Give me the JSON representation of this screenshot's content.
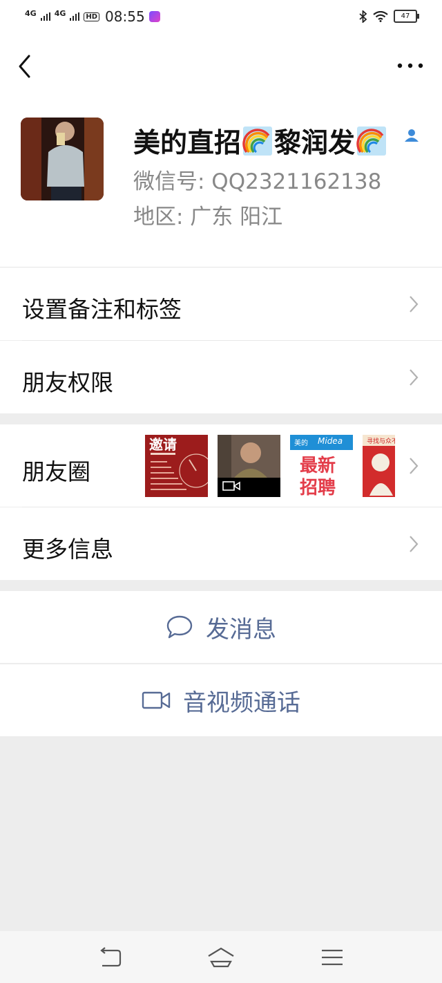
{
  "status_bar": {
    "signal_1": "4G",
    "signal_2": "4G",
    "hd": "HD",
    "time": "08:55",
    "battery": "47"
  },
  "nav": {
    "back_icon": "chevron-left-icon",
    "more_icon": "more-dots-icon"
  },
  "profile": {
    "avatar_icon": "avatar-photo",
    "name_parts": [
      "美的直招",
      "黎润发"
    ],
    "emoji_icon": "rainbow-emoji",
    "wechat_id": "微信号:  QQ2321162138",
    "region": "地区:  广东  阳江"
  },
  "menu": {
    "remark_tags": "设置备注和标签",
    "permissions": "朋友权限",
    "moments": "朋友圈",
    "more_info": "更多信息"
  },
  "moments_thumbs": {
    "t1_title": "邀请",
    "t3_brand_left": "美的",
    "t3_brand_right": "Midea",
    "t3_line1": "最新",
    "t3_line2": "招聘",
    "t4_title": "寻找与众不"
  },
  "actions": {
    "message": "发消息",
    "call": "音视频通话"
  },
  "colors": {
    "link": "#576b95",
    "background": "#ededed"
  }
}
